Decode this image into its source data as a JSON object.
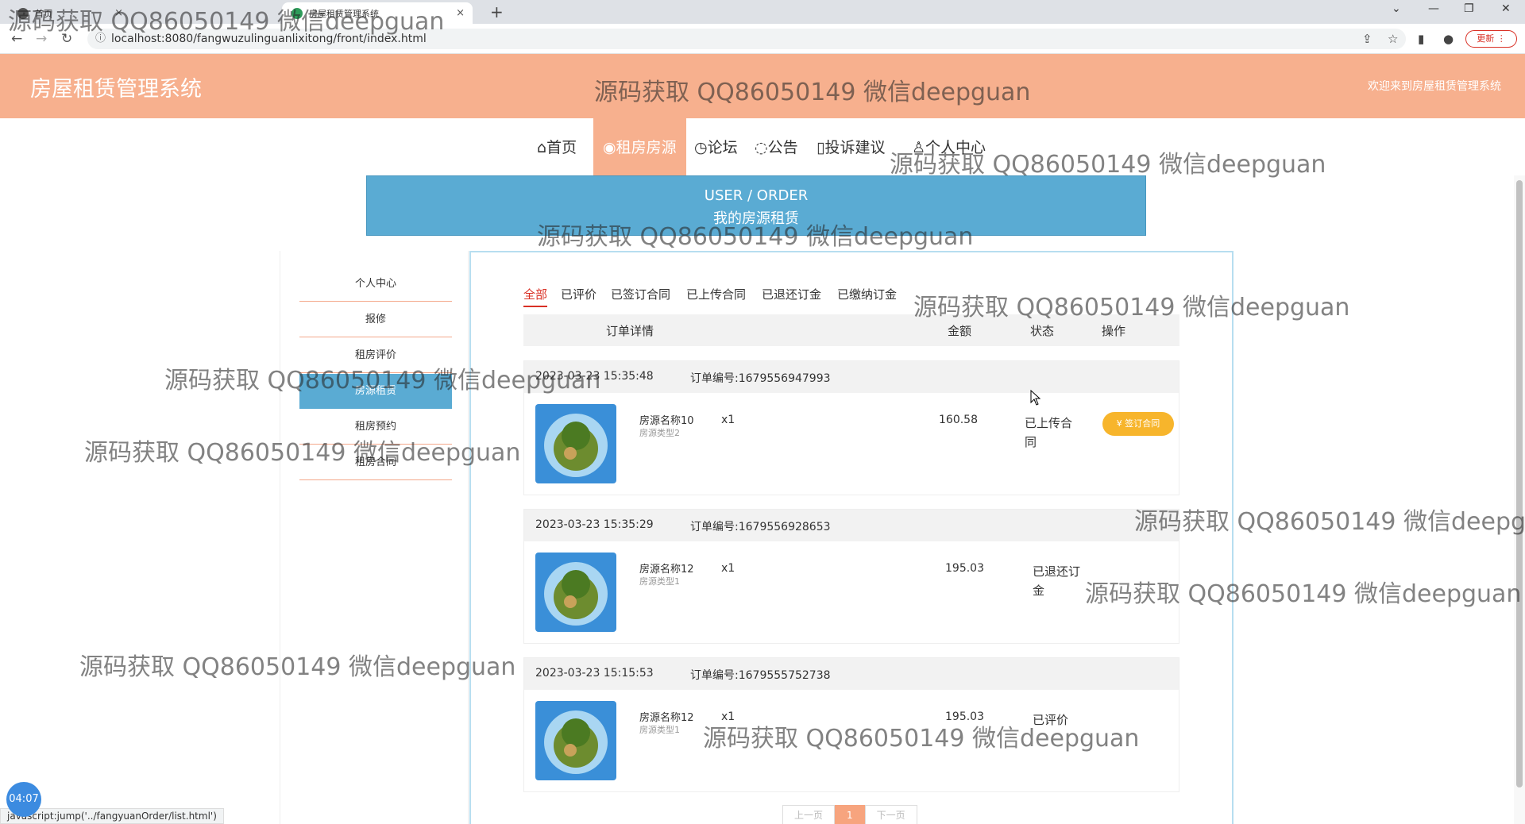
{
  "browser": {
    "tabs": [
      {
        "label": "首页"
      },
      {
        "label": "房屋租赁管理系统"
      }
    ],
    "url": "localhost:8080/fangwuzulinguanlixitong/front/index.html",
    "update_label": "更新",
    "status_url": "javascript:jump('../fangyuanOrder/list.html')",
    "time_badge": "04:07"
  },
  "header": {
    "title": "房屋租赁管理系统",
    "welcome": "欢迎来到房屋租赁管理系统"
  },
  "nav": [
    {
      "label": "首页",
      "icon": "home-icon",
      "glyph": "⌂"
    },
    {
      "label": "租房房源",
      "icon": "house-icon",
      "glyph": "◉",
      "active": true
    },
    {
      "label": "论坛",
      "icon": "forum-icon",
      "glyph": "◷"
    },
    {
      "label": "公告",
      "icon": "notice-icon",
      "glyph": "◌"
    },
    {
      "label": "投诉建议",
      "icon": "feedback-icon",
      "glyph": "▯"
    },
    {
      "label": "个人中心",
      "icon": "user-icon",
      "glyph": "♙"
    }
  ],
  "banner": {
    "en": "USER / ORDER",
    "cn": "我的房源租赁"
  },
  "sidebar": [
    {
      "label": "个人中心"
    },
    {
      "label": "报修"
    },
    {
      "label": "租房评价"
    },
    {
      "label": "房源租赁",
      "active": true
    },
    {
      "label": "租房预约"
    },
    {
      "label": "租房合同"
    }
  ],
  "filters": [
    "全部",
    "已评价",
    "已签订合同",
    "已上传合同",
    "已退还订金",
    "已缴纳订金"
  ],
  "table_headers": {
    "detail": "订单详情",
    "amount": "金额",
    "status": "状态",
    "action": "操作"
  },
  "orders": [
    {
      "time": "2023-03-23 15:35:48",
      "order_no": "订单编号:1679556947993",
      "name": "房源名称10",
      "type": "房源类型2",
      "qty": "x1",
      "price": "160.58",
      "status": "已上传合同",
      "action": "签订合同"
    },
    {
      "time": "2023-03-23 15:35:29",
      "order_no": "订单编号:1679556928653",
      "name": "房源名称12",
      "type": "房源类型1",
      "qty": "x1",
      "price": "195.03",
      "status": "已退还订金"
    },
    {
      "time": "2023-03-23 15:15:53",
      "order_no": "订单编号:1679555752738",
      "name": "房源名称12",
      "type": "房源类型1",
      "qty": "x1",
      "price": "195.03",
      "status": "已评价"
    }
  ],
  "pager": {
    "prev": "上一页",
    "current": "1",
    "next": "下一页"
  },
  "watermark": "源码获取 QQ86050149 微信deepguan",
  "colors": {
    "header": "#f7b08e",
    "banner": "#5aabd3",
    "action": "#f7b52c",
    "active_filter": "#d93025"
  }
}
